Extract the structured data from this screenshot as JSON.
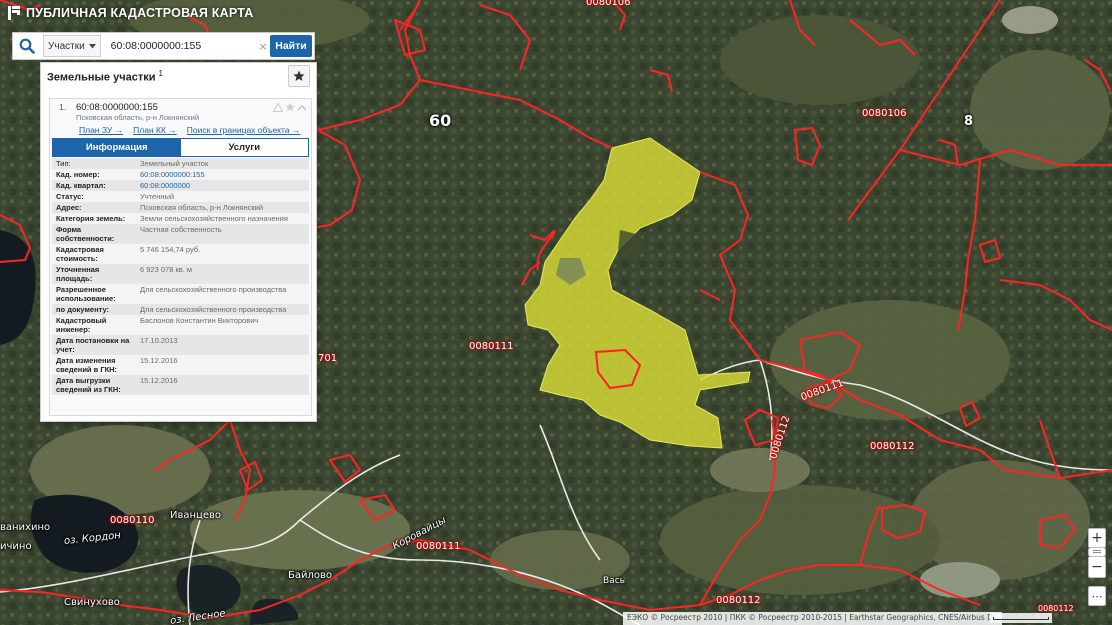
{
  "app": {
    "title": "ПУБЛИЧНАЯ КАДАСТРОВАЯ КАРТА"
  },
  "search": {
    "type_label": "Участки",
    "query": "60:08:0000000:155",
    "clear_symbol": "×",
    "button_label": "Найти"
  },
  "panel": {
    "title": "Земельные участки",
    "count": "1",
    "result": {
      "number": "1.",
      "cad_number": "60:08:0000000:155",
      "address": "Псковская область, р-н Локнянский",
      "links": [
        "План ЗУ →",
        "План КК →",
        "Поиск в границах объекта →"
      ],
      "tabs": [
        {
          "label": "Информация",
          "active": true
        },
        {
          "label": "Услуги",
          "active": false
        }
      ],
      "rows": [
        {
          "key": "Тип:",
          "value": "Земельный участок"
        },
        {
          "key": "Кад. номер:",
          "value": "60:08:0000000:155",
          "link": true
        },
        {
          "key": "Кад. квартал:",
          "value": "60:08:0000000",
          "link": true
        },
        {
          "key": "Статус:",
          "value": "Учтенный"
        },
        {
          "key": "Адрес:",
          "value": "Псковская область, р-н Локнянский"
        },
        {
          "key": "Категория земель:",
          "value": "Земли сельскохозяйственного назначения"
        },
        {
          "key": "Форма собственности:",
          "value": "Частная собственность"
        },
        {
          "key": "Кадастровая стоимость:",
          "value": "5 746 154,74 руб."
        },
        {
          "key": "Уточненная площадь:",
          "value": "6 923 078 кв. м"
        },
        {
          "key": "Разрешенное использование:",
          "value": "Для сельскохозяйственного производства"
        },
        {
          "key": "по документу:",
          "value": "Для сельскохозяйственного производства"
        },
        {
          "key": "Кадастровый инженер:",
          "value": "Баслонов Константин Викторович"
        },
        {
          "key": "Дата постановки на учет:",
          "value": "17.10.2013"
        },
        {
          "key": "Дата изменения сведений в ГКН:",
          "value": "15.12.2016"
        },
        {
          "key": "Дата выгрузки сведений из ГКН:",
          "value": "15.12.2016"
        }
      ]
    }
  },
  "map": {
    "labels": [
      {
        "text": "0080106",
        "style": "kvartal-red"
      },
      {
        "text": "60",
        "style": "road"
      },
      {
        "text": "0080106",
        "style": "kvartal-red"
      },
      {
        "text": "8",
        "style": "road"
      },
      {
        "text": "0080111",
        "style": "kvartal-red"
      },
      {
        "text": "701",
        "style": "kvartal-red"
      },
      {
        "text": "0080111",
        "style": "kvartal-red"
      },
      {
        "text": "0080112",
        "style": "kvartal-red"
      },
      {
        "text": "0080112",
        "style": "kvartal-red"
      },
      {
        "text": "0080110",
        "style": "kvartal-red"
      },
      {
        "text": "0080111",
        "style": "kvartal-red"
      },
      {
        "text": "0080112",
        "style": "kvartal-red"
      },
      {
        "text": "0080112",
        "style": "kvartal-red"
      },
      {
        "text": "Иванцево",
        "style": "place"
      },
      {
        "text": "ванихино",
        "style": "place"
      },
      {
        "text": "ичино",
        "style": "place"
      },
      {
        "text": "оз. Кордон",
        "style": "place"
      },
      {
        "text": "Коровайцы",
        "style": "place"
      },
      {
        "text": "Байлово",
        "style": "place"
      },
      {
        "text": "Свинухово",
        "style": "place"
      },
      {
        "text": "Вась",
        "style": "place"
      },
      {
        "text": "оз. Лесное",
        "style": "place"
      }
    ],
    "parcel_color": "#e0e23a",
    "boundary_color": "#ff2020",
    "road_color": "#ffffff"
  },
  "controls": {
    "zoom_in": "+",
    "zoom_out": "−",
    "menu": "⋯"
  },
  "attribution": "ЕЭКО © Росреестр 2010 | ПКК © Росреестр 2010-2015 | Earthstar Geographics, CNES/Airbus DS"
}
